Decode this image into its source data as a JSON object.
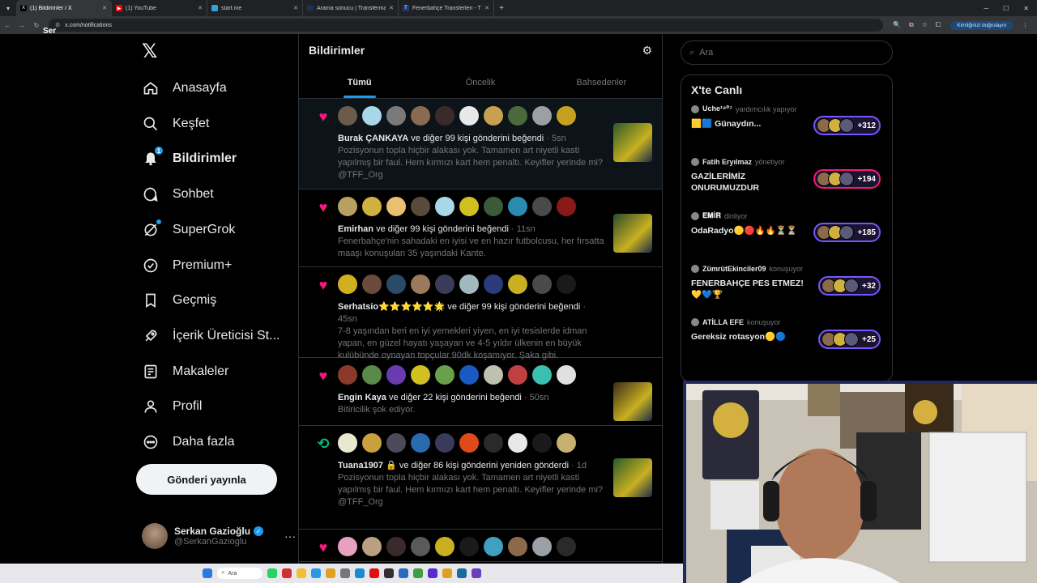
{
  "browser": {
    "tabs": [
      {
        "title": "(1) Bildirimler / X",
        "color": "#000000",
        "glyph": "X"
      },
      {
        "title": "(1) YouTube",
        "color": "#ff0000",
        "glyph": "▶"
      },
      {
        "title": "start.me",
        "color": "#2aa7e0",
        "glyph": ""
      },
      {
        "title": "Arama sonucu | Transfermarkt",
        "color": "#1a3151",
        "glyph": ""
      },
      {
        "title": "Fenerbahçe Transferleri - Tüm S...",
        "color": "#1a3a7a",
        "glyph": "T"
      }
    ],
    "url": "x.com/notifications",
    "verify_label": "Kimliğinizi doğrulayın",
    "url_overlay": "Ser"
  },
  "nav": {
    "items": [
      {
        "label": "Anasayfa",
        "icon": "home-icon"
      },
      {
        "label": "Keşfet",
        "icon": "search-icon"
      },
      {
        "label": "Bildirimler",
        "icon": "bell-icon",
        "badge": "1"
      },
      {
        "label": "Sohbet",
        "icon": "chat-icon"
      },
      {
        "label": "SuperGrok",
        "icon": "grok-icon"
      },
      {
        "label": "Premium+",
        "icon": "premium-icon"
      },
      {
        "label": "Geçmiş",
        "icon": "bookmark-icon"
      },
      {
        "label": "İçerik Üreticisi St...",
        "icon": "rocket-icon"
      },
      {
        "label": "Makaleler",
        "icon": "article-icon"
      },
      {
        "label": "Profil",
        "icon": "profile-icon"
      },
      {
        "label": "Daha fazla",
        "icon": "more-circle-icon"
      }
    ],
    "post_button": "Gönderi yayınla",
    "profile_name": "Serkan Gazioğlu",
    "profile_handle": "@SerkanGazioglu"
  },
  "center": {
    "title": "Bildirimler",
    "tabs": [
      "Tümü",
      "Öncelik",
      "Bahsedenler"
    ],
    "notifications": [
      {
        "kind": "like",
        "actor": "Burak ÇANKAYA",
        "action": " ve diğer 99 kişi gönderini beğendi",
        "time": " · 5sn",
        "body": "Pozisyonun topla hiçbir alakası yok. Tamamen art niyetli kasti yapılmış bir faul. Hem kırmızı kart hem penaltı. Keyifler yerinde mi? @TFF_Org",
        "avatars": [
          "#6b5b4a",
          "#a8d8e8",
          "#7a7a7a",
          "#8a6a50",
          "#3a2a2a",
          "#e8e8e8",
          "#c9a050",
          "#4a6a3a",
          "#9aa0a6",
          "#c8a020"
        ]
      },
      {
        "kind": "like",
        "actor": "Emirhan",
        "action": " ve diğer 99 kişi gönderini beğendi",
        "time": " · 11sn",
        "body": "Fenerbahçe'nin sahadaki en iyisi ve en hazır futbolcusu, her fırsatta maaşı konuşulan 35 yaşındaki Kante.",
        "avatars": [
          "#b8a060",
          "#d0b040",
          "#e8c070",
          "#5a4a3a",
          "#a8d8e8",
          "#d0c020",
          "#3a5a3a",
          "#2a8ab0",
          "#4a4a4a",
          "#8a1a1a"
        ]
      },
      {
        "kind": "like",
        "actor": "Serhatsio⭐⭐⭐⭐⭐🌟",
        "action": " ve diğer 99 kişi gönderini beğendi",
        "time": " · 45sn",
        "body": "7-8 yaşından beri en iyi yemekleri yiyen, en iyi tesislerde idman yapan, en güzel hayatı yaşayan ve 4-5 yıldır ülkenin en büyük kulübünde oynayan topçular 90dk koşamıyor. Şaka gibi.",
        "avatars": [
          "#d0b020",
          "#6a4a3a",
          "#2a4a6a",
          "#9a7a5a",
          "#3a3a5a",
          "#a0b8c0",
          "#2a3a7a",
          "#c8b020",
          "#4a4a4a",
          "#1a1a1a"
        ]
      },
      {
        "kind": "like",
        "actor": "Engin Kaya",
        "action": " ve diğer 22 kişi gönderini beğendi",
        "time": " · 50sn",
        "body": "Bitiricilik şok ediyor.",
        "avatars": [
          "#8a3a2a",
          "#5a8a4a",
          "#6a3ab0",
          "#d0c020",
          "#6aa04a",
          "#1a5ac0",
          "#c0c0b0",
          "#c04040",
          "#3ac0b0",
          "#e0e0e0"
        ]
      },
      {
        "kind": "retweet",
        "actor": "Tuana1907",
        "action": " 🔒 ve diğer 86 kişi gönderini yeniden gönderdi",
        "time": " · 1d",
        "body": "Pozisyonun topla hiçbir alakası yok. Tamamen art niyetli kasti yapılmış bir faul. Hem kırmızı kart hem penaltı. Keyifler yerinde mi? @TFF_Org",
        "avatars": [
          "#e8e8d0",
          "#c8a040",
          "#4a4a5a",
          "#2a6ab0",
          "#3a3a5a",
          "#e04a1a",
          "#2a2a2a",
          "#e8e8e8",
          "#1a1a1a",
          "#c8b070"
        ]
      },
      {
        "kind": "like",
        "actor": "",
        "action": "",
        "time": "",
        "body": "",
        "avatars": [
          "#e8a0c0",
          "#b8a080",
          "#3a2a2a",
          "#5a5a5a",
          "#c8b020",
          "#1a1a1a",
          "#40a0c0",
          "#8a6a4a",
          "#9aa0a6",
          "#2a2a2a"
        ]
      }
    ]
  },
  "right": {
    "search_placeholder": "Ara",
    "live_title": "X'te Canlı",
    "spaces": [
      {
        "host": "Uche¹⁹⁰⁷",
        "status": "yardımcılık yapıyor",
        "title": "🟨🟦 Günaydın...",
        "count": "+312",
        "pill": "purple"
      },
      {
        "host": "Fatih Eryılmaz",
        "status": "yönetiyor",
        "title": "GAZİLERİMİZ ONURUMUZDUR",
        "count": "+194",
        "pill": "pink"
      },
      {
        "host": "𝐄𝐌İ𝐑",
        "status": "dinliyor",
        "title": "OdaRadyo🟡🔴🔥🔥⏳⏳",
        "count": "+185",
        "pill": "purple"
      },
      {
        "host": "ZümrütEkinciler09",
        "status": "konuşuyor",
        "title": "FENERBAHÇE PES ETMEZ! 💛💙🏆",
        "count": "+32",
        "pill": "purple"
      },
      {
        "host": "ATİLLA EFE",
        "status": "konuşuyor",
        "title": "Gereksiz rotasyon🟡🔵",
        "count": "+25",
        "pill": "purple"
      }
    ]
  },
  "taskbar": {
    "search": "Ara"
  }
}
